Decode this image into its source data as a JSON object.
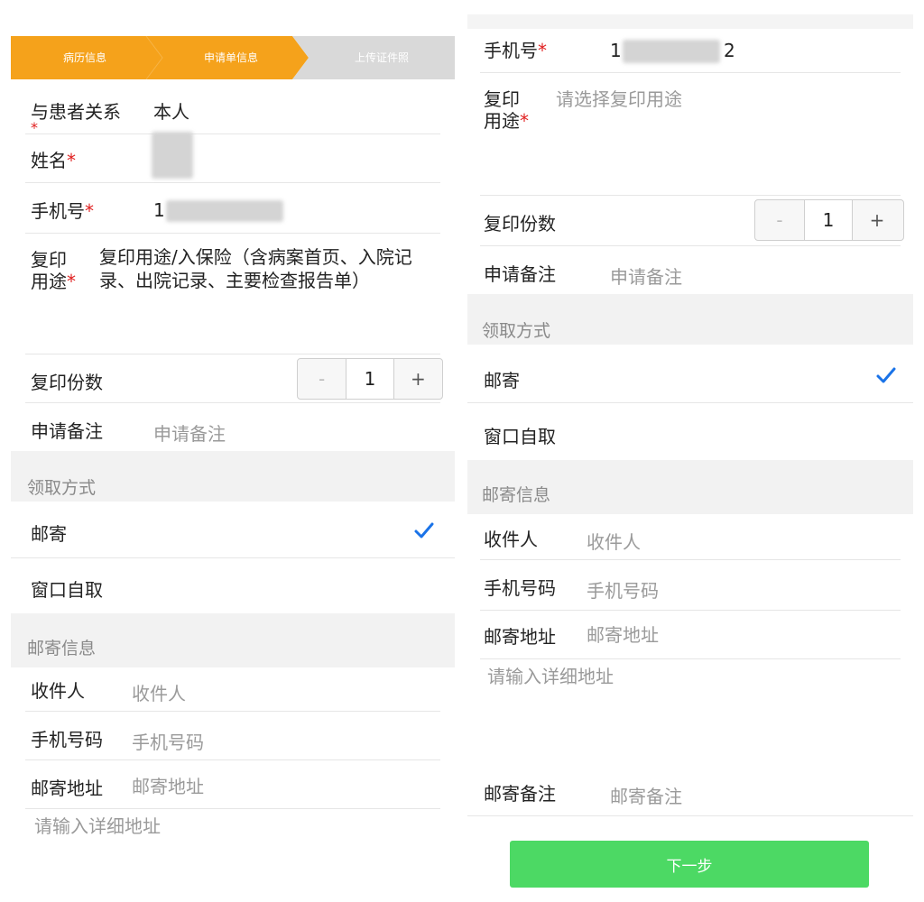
{
  "steps": [
    "病历信息",
    "申请单信息",
    "上传证件照"
  ],
  "left": {
    "relation_label": "与患者关系",
    "relation_value": "本人",
    "name_label": "姓名",
    "phone_label": "手机号",
    "phone_prefix": "1",
    "purpose_label_1": "复印",
    "purpose_label_2": "用途",
    "purpose_value": "复印用途/入保险（含病案首页、入院记录、出院记录、主要检查报告单）",
    "copies_label": "复印份数",
    "copies_value": "1",
    "remark_label": "申请备注",
    "remark_placeholder": "申请备注",
    "pickup_section": "领取方式",
    "option_mail": "邮寄",
    "option_window": "窗口自取",
    "mail_section": "邮寄信息",
    "recipient_label": "收件人",
    "recipient_placeholder": "收件人",
    "mobile_label": "手机号码",
    "mobile_placeholder": "手机号码",
    "address_label": "邮寄地址",
    "address_placeholder": "邮寄地址",
    "detail_placeholder": "请输入详细地址"
  },
  "right": {
    "phone_label": "手机号",
    "phone_prefix": "1",
    "phone_suffix": "2",
    "purpose_label_1": "复印",
    "purpose_label_2": "用途",
    "purpose_placeholder": "请选择复印用途",
    "copies_label": "复印份数",
    "copies_value": "1",
    "remark_label": "申请备注",
    "remark_placeholder": "申请备注",
    "pickup_section": "领取方式",
    "option_mail": "邮寄",
    "option_window": "窗口自取",
    "mail_section": "邮寄信息",
    "recipient_label": "收件人",
    "recipient_placeholder": "收件人",
    "mobile_label": "手机号码",
    "mobile_placeholder": "手机号码",
    "address_label": "邮寄地址",
    "address_placeholder": "邮寄地址",
    "detail_placeholder": "请输入详细地址",
    "mail_remark_label": "邮寄备注",
    "mail_remark_placeholder": "邮寄备注",
    "next_button": "下一步"
  },
  "common": {
    "asterisk": "*",
    "minus": "-",
    "plus": "+"
  },
  "colors": {
    "step_active": "#f5a21b",
    "step_inactive": "#d9d9d9",
    "check": "#1a73e8",
    "next": "#4cd964",
    "required": "#e02020"
  }
}
